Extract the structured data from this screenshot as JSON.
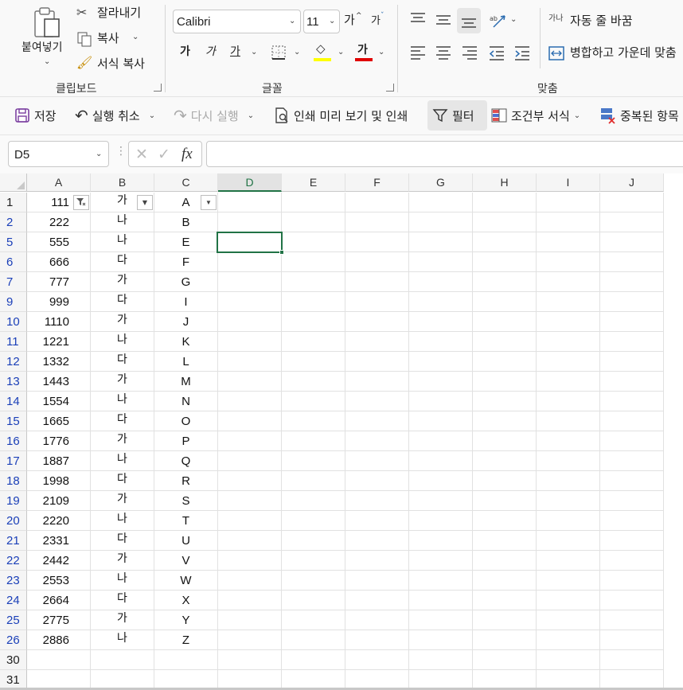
{
  "ribbon": {
    "clipboard": {
      "paste": "붙여넣기",
      "cut": "잘라내기",
      "copy": "복사",
      "format_painter": "서식 복사",
      "group_label": "클립보드"
    },
    "font": {
      "name": "Calibri",
      "size": "11",
      "grow": "가",
      "shrink": "가",
      "bold": "가",
      "italic": "가",
      "underline": "가",
      "font_color_glyph": "가",
      "font_color": "#e00000",
      "fill_color": "#ffff00",
      "group_label": "글꼴"
    },
    "alignment": {
      "wrap_text": "자동 줄 바꿈",
      "merge_center": "병합하고 가운데 맞춤",
      "group_label": "맞춤",
      "wrap_icon_text": "가나"
    }
  },
  "qat": {
    "save": "저장",
    "undo": "실행 취소",
    "redo": "다시 실행",
    "print_preview": "인쇄 미리 보기 및 인쇄",
    "filter": "필터",
    "conditional_format": "조건부 서식",
    "remove_duplicates": "중복된 항목"
  },
  "formula_bar": {
    "name_box": "D5",
    "formula": "",
    "fx": "fx"
  },
  "sheet": {
    "columns": [
      "A",
      "B",
      "C",
      "D",
      "E",
      "F",
      "G",
      "H",
      "I",
      "J"
    ],
    "active_column": "D",
    "active_cell": "D5",
    "header_row": {
      "row": "1",
      "a": "111",
      "b": "가",
      "c": "A"
    },
    "rows": [
      {
        "row": "2",
        "a": "222",
        "b": "나",
        "c": "B"
      },
      {
        "row": "5",
        "a": "555",
        "b": "나",
        "c": "E"
      },
      {
        "row": "6",
        "a": "666",
        "b": "다",
        "c": "F"
      },
      {
        "row": "7",
        "a": "777",
        "b": "가",
        "c": "G"
      },
      {
        "row": "9",
        "a": "999",
        "b": "다",
        "c": "I"
      },
      {
        "row": "10",
        "a": "1110",
        "b": "가",
        "c": "J"
      },
      {
        "row": "11",
        "a": "1221",
        "b": "나",
        "c": "K"
      },
      {
        "row": "12",
        "a": "1332",
        "b": "다",
        "c": "L"
      },
      {
        "row": "13",
        "a": "1443",
        "b": "가",
        "c": "M"
      },
      {
        "row": "14",
        "a": "1554",
        "b": "나",
        "c": "N"
      },
      {
        "row": "15",
        "a": "1665",
        "b": "다",
        "c": "O"
      },
      {
        "row": "16",
        "a": "1776",
        "b": "가",
        "c": "P"
      },
      {
        "row": "17",
        "a": "1887",
        "b": "나",
        "c": "Q"
      },
      {
        "row": "18",
        "a": "1998",
        "b": "다",
        "c": "R"
      },
      {
        "row": "19",
        "a": "2109",
        "b": "가",
        "c": "S"
      },
      {
        "row": "20",
        "a": "2220",
        "b": "나",
        "c": "T"
      },
      {
        "row": "21",
        "a": "2331",
        "b": "다",
        "c": "U"
      },
      {
        "row": "22",
        "a": "2442",
        "b": "가",
        "c": "V"
      },
      {
        "row": "23",
        "a": "2553",
        "b": "나",
        "c": "W"
      },
      {
        "row": "24",
        "a": "2664",
        "b": "다",
        "c": "X"
      },
      {
        "row": "25",
        "a": "2775",
        "b": "가",
        "c": "Y"
      },
      {
        "row": "26",
        "a": "2886",
        "b": "나",
        "c": "Z"
      }
    ],
    "trailing_rows": [
      "30",
      "31"
    ]
  },
  "colors": {
    "row_number_filtered": "#1a3fb8",
    "selection": "#217346"
  }
}
